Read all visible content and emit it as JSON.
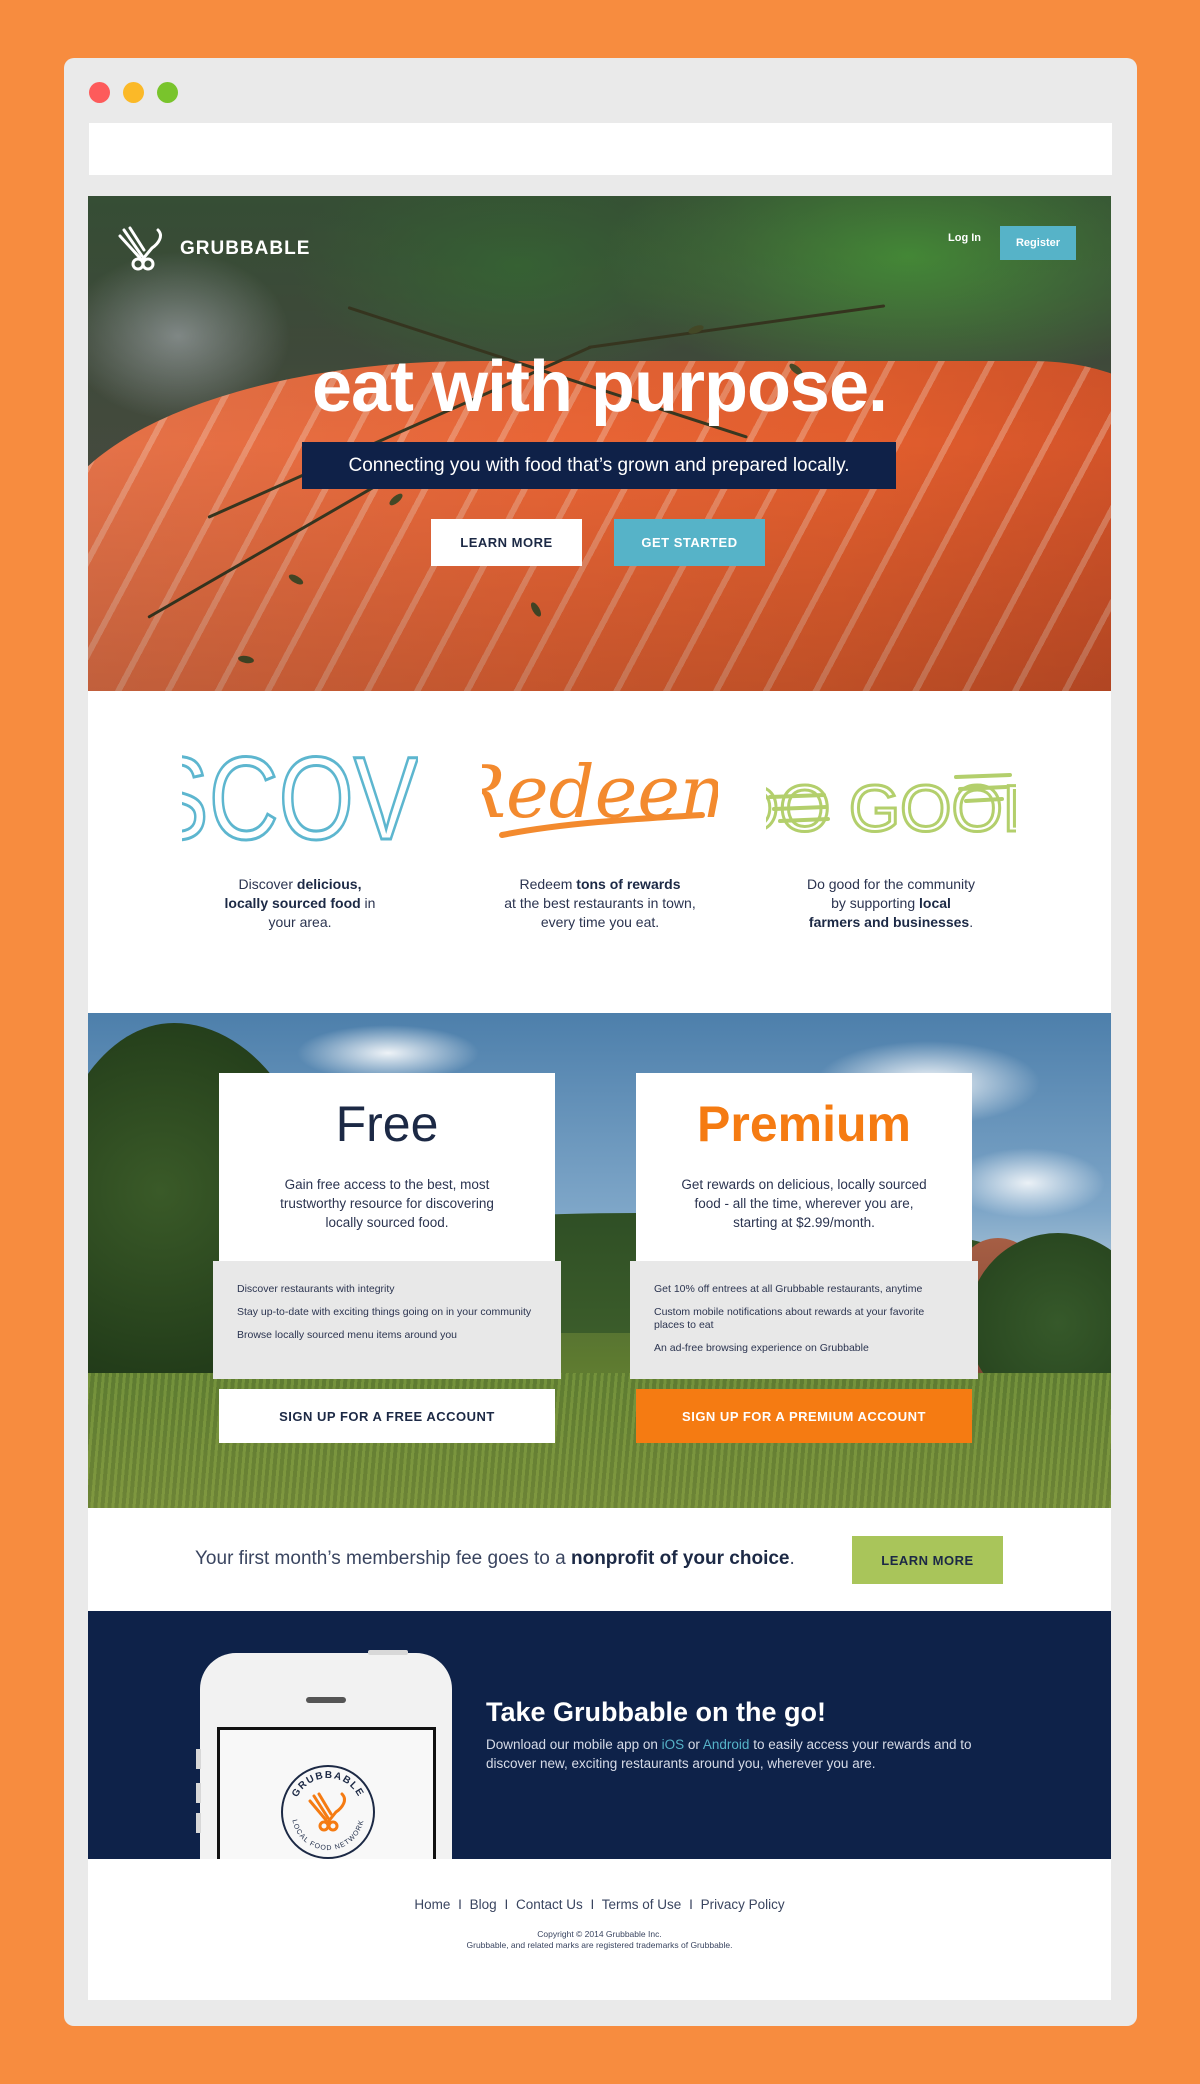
{
  "window": {
    "controls": [
      "close",
      "minimize",
      "maximize"
    ]
  },
  "header": {
    "brand": "GRUBBABLE",
    "login_label": "Log In",
    "register_label": "Register"
  },
  "hero": {
    "title": "eat with purpose.",
    "subtitle": "Connecting you with food that’s grown and prepared locally.",
    "learn_more_label": "LEARN MORE",
    "get_started_label": "GET STARTED"
  },
  "features": [
    {
      "heading": "DISCOVER",
      "text_a": "Discover ",
      "text_b": "delicious,",
      "text_c": "locally sourced food",
      "text_d": " in",
      "text_e": "your area."
    },
    {
      "heading": "Redeem",
      "text_a": "Redeem ",
      "text_b": "tons of rewards",
      "text_c": "at the best restaurants in town,",
      "text_d": "every time you eat."
    },
    {
      "heading": "DO GOOD",
      "text_a": "Do good for the community",
      "text_b": "by supporting ",
      "text_c": "local",
      "text_d": "farmers and businesses",
      "text_e": "."
    }
  ],
  "plans": {
    "free": {
      "title": "Free",
      "description": "Gain free access to the best, most trustworthy resource for discovering locally sourced food.",
      "items": [
        "Discover restaurants with integrity",
        "Stay up-to-date with exciting things going on in your community",
        "Browse locally sourced menu items around you"
      ],
      "button_label": "SIGN UP FOR A FREE ACCOUNT"
    },
    "premium": {
      "title": "Premium",
      "description": "Get rewards on delicious, locally sourced food - all the time, wherever you are, starting at $2.99/month.",
      "items": [
        "Get 10% off entrees at all Grubbable restaurants, anytime",
        "Custom mobile notifications about rewards at your favorite places to eat",
        "An ad-free browsing experience on Grubbable"
      ],
      "button_label": "SIGN UP FOR A PREMIUM ACCOUNT"
    }
  },
  "nonprofit": {
    "text_before": "Your first month’s membership fee goes to a ",
    "text_bold": "nonprofit of your choice",
    "text_after": ".",
    "button_label": "LEARN MORE"
  },
  "mobile": {
    "title": "Take Grubbable on the go!",
    "desc_a": "Download our mobile app on ",
    "ios_label": "iOS",
    "desc_b": " or ",
    "android_label": "Android",
    "desc_c": " to easily access your rewards and to discover new, exciting restaurants around you, wherever you are.",
    "seal_top": "GRUBBABLE",
    "seal_bottom": "LOCAL FOOD NETWORK"
  },
  "footer": {
    "links": [
      "Home",
      "Blog",
      "Contact Us",
      "Terms of Use",
      "Privacy Policy"
    ],
    "separator": "I",
    "copyright": "Copyright © 2014 Grubbable Inc.",
    "trademark": "Grubbable, and related marks are registered trademarks of Grubbable."
  },
  "colors": {
    "background": "#f78c3f",
    "navy": "#0e2249",
    "teal": "#56b3c8",
    "orange": "#f57b12",
    "green": "#a9c55a"
  }
}
